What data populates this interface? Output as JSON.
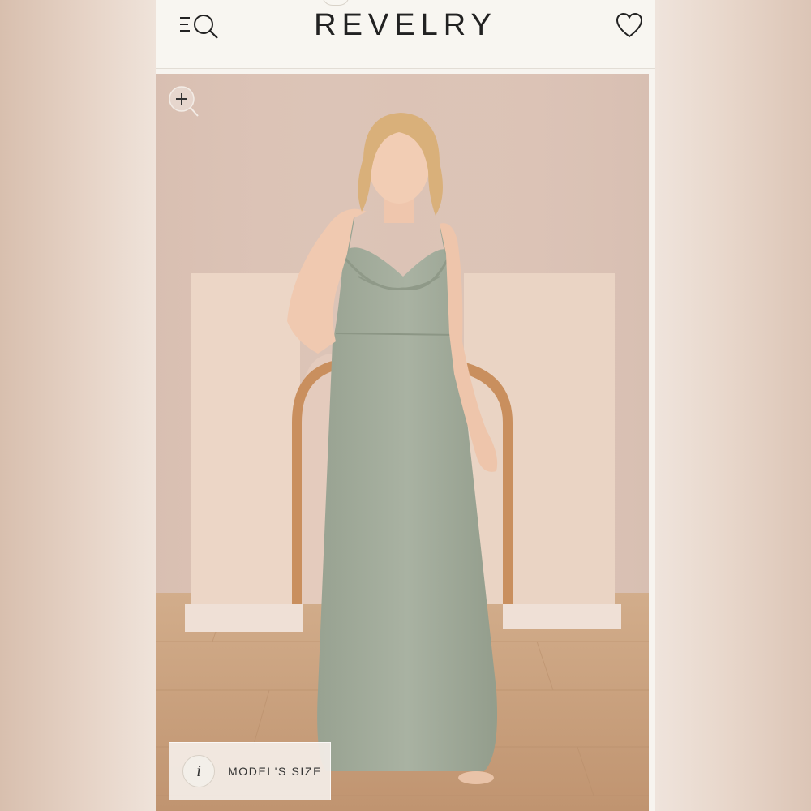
{
  "header": {
    "logo_text": "REVELRY",
    "icons": [
      "menu-search-icon",
      "heart-icon"
    ]
  },
  "product_image": {
    "zoom_icon": "zoom-in-icon",
    "model_size_button": {
      "icon": "info-icon",
      "icon_glyph": "i",
      "label": "MODEL'S SIZE"
    }
  },
  "colors": {
    "header_bg": "#f8f6f1",
    "wall": "#dfc5b8",
    "dress": "#a3ad9c",
    "floor": "#c8a07a"
  }
}
